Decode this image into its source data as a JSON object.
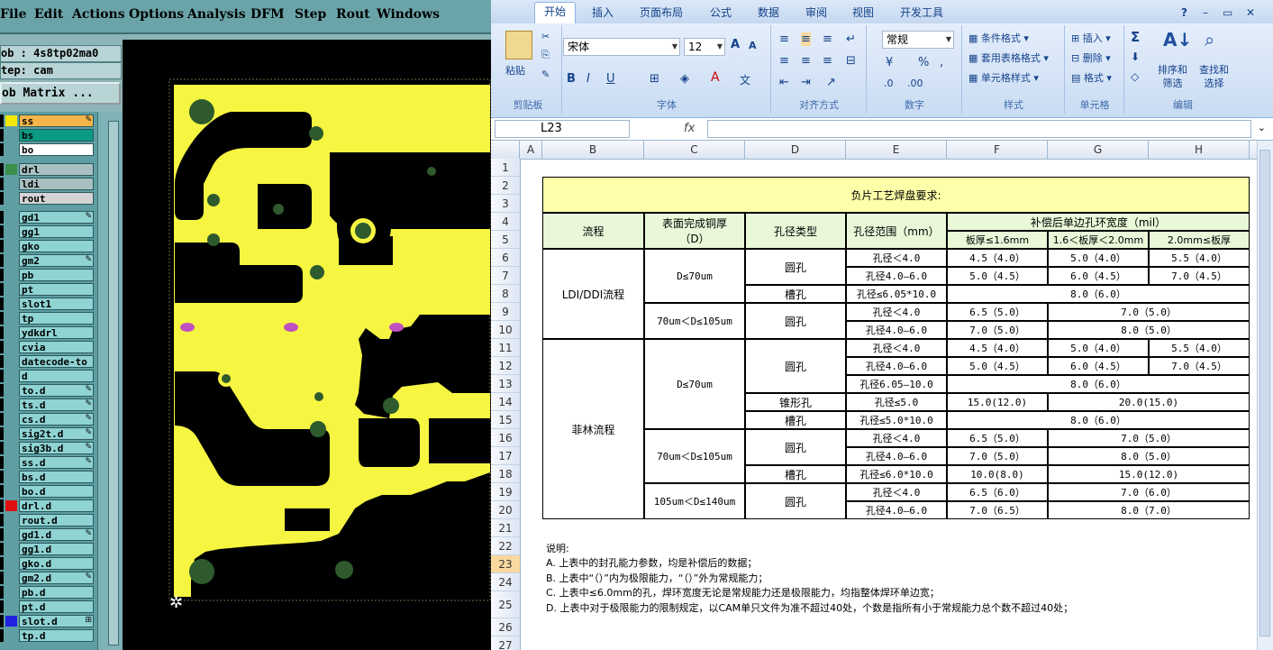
{
  "cam": {
    "menu": [
      "File",
      "Edit",
      "Actions",
      "Options",
      "Analysis",
      "DFM",
      "Step",
      "Rout",
      "Windows"
    ],
    "job": "ob : 4s8tp02ma0",
    "step": "tep: cam",
    "matrix_button": "ob Matrix ...",
    "layers": [
      {
        "name": "ss",
        "bg": "#f5b54a",
        "sw": "#f5e800",
        "mark": "✎"
      },
      {
        "name": "bs",
        "bg": "#0b9b83",
        "sw": "",
        "mark": ""
      },
      {
        "name": "bo",
        "bg": "#ffffff",
        "sw": "",
        "mark": ""
      },
      {
        "name": "drl",
        "bg": "#a9c0c2",
        "sw": "#3a8f4a",
        "mark": ""
      },
      {
        "name": "ldi",
        "bg": "#a9c0c2",
        "sw": "",
        "mark": ""
      },
      {
        "name": "rout",
        "bg": "#d4d4d4",
        "sw": "",
        "mark": ""
      },
      {
        "name": "gd1",
        "bg": "#8fd3d3",
        "sw": "",
        "mark": "✎"
      },
      {
        "name": "gg1",
        "bg": "#8fd3d3",
        "sw": "",
        "mark": ""
      },
      {
        "name": "gko",
        "bg": "#8fd3d3",
        "sw": "",
        "mark": ""
      },
      {
        "name": "gm2",
        "bg": "#8fd3d3",
        "sw": "",
        "mark": "✎"
      },
      {
        "name": "pb",
        "bg": "#8fd3d3",
        "sw": "",
        "mark": ""
      },
      {
        "name": "pt",
        "bg": "#8fd3d3",
        "sw": "",
        "mark": ""
      },
      {
        "name": "slot1",
        "bg": "#8fd3d3",
        "sw": "",
        "mark": ""
      },
      {
        "name": "tp",
        "bg": "#8fd3d3",
        "sw": "",
        "mark": ""
      },
      {
        "name": "ydkdrl",
        "bg": "#8fd3d3",
        "sw": "",
        "mark": ""
      },
      {
        "name": "cvia",
        "bg": "#8fd3d3",
        "sw": "",
        "mark": ""
      },
      {
        "name": "datecode-to",
        "bg": "#8fd3d3",
        "sw": "",
        "mark": ""
      },
      {
        "name": "d",
        "bg": "#8fd3d3",
        "sw": "",
        "mark": ""
      },
      {
        "name": "to.d",
        "bg": "#8fd3d3",
        "sw": "",
        "mark": "✎"
      },
      {
        "name": "ts.d",
        "bg": "#8fd3d3",
        "sw": "",
        "mark": "✎"
      },
      {
        "name": "cs.d",
        "bg": "#8fd3d3",
        "sw": "",
        "mark": "✎"
      },
      {
        "name": "sig2t.d",
        "bg": "#8fd3d3",
        "sw": "",
        "mark": "✎"
      },
      {
        "name": "sig3b.d",
        "bg": "#8fd3d3",
        "sw": "",
        "mark": "✎"
      },
      {
        "name": "ss.d",
        "bg": "#8fd3d3",
        "sw": "",
        "mark": "✎"
      },
      {
        "name": "bs.d",
        "bg": "#8fd3d3",
        "sw": "",
        "mark": ""
      },
      {
        "name": "bo.d",
        "bg": "#8fd3d3",
        "sw": "",
        "mark": ""
      },
      {
        "name": "drl.d",
        "bg": "#8fd3d3",
        "sw": "#e01010",
        "mark": ""
      },
      {
        "name": "rout.d",
        "bg": "#8fd3d3",
        "sw": "",
        "mark": ""
      },
      {
        "name": "gd1.d",
        "bg": "#8fd3d3",
        "sw": "",
        "mark": "✎"
      },
      {
        "name": "gg1.d",
        "bg": "#8fd3d3",
        "sw": "",
        "mark": ""
      },
      {
        "name": "gko.d",
        "bg": "#8fd3d3",
        "sw": "",
        "mark": ""
      },
      {
        "name": "gm2.d",
        "bg": "#8fd3d3",
        "sw": "",
        "mark": "✎"
      },
      {
        "name": "pb.d",
        "bg": "#8fd3d3",
        "sw": "",
        "mark": ""
      },
      {
        "name": "pt.d",
        "bg": "#8fd3d3",
        "sw": "",
        "mark": ""
      },
      {
        "name": "slot.d",
        "bg": "#8fd3d3",
        "sw": "#2020e0",
        "mark": "⊞"
      },
      {
        "name": "tp.d",
        "bg": "#8fd3d3",
        "sw": "",
        "mark": ""
      }
    ],
    "colors": {
      "copper": "#f5f542",
      "board": "#000000",
      "pad": "#2e5a2e",
      "slot": "#c050c0"
    }
  },
  "excel": {
    "tabs": [
      "开始",
      "插入",
      "页面布局",
      "公式",
      "数据",
      "审阅",
      "视图",
      "开发工具"
    ],
    "ribbon": {
      "paste": "粘贴",
      "clipboard": "剪贴板",
      "font_name": "宋体",
      "font_size": "12",
      "font_group": "字体",
      "align_group": "对齐方式",
      "number_format": "常规",
      "number_group": "数字",
      "cond_format": "条件格式",
      "table_format": "套用表格格式",
      "cell_style": "单元格样式",
      "style_group": "样式",
      "insert": "插入",
      "delete": "删除",
      "format": "格式",
      "cells_group": "单元格",
      "sort_filter": "排序和\n筛选",
      "find_select": "查找和\n选择",
      "edit_group": "编辑",
      "sigma": "Σ"
    },
    "name_box": "L23",
    "fx": "fx",
    "columns": [
      "A",
      "B",
      "C",
      "D",
      "E",
      "F",
      "G",
      "H"
    ],
    "rows": [
      "1",
      "2",
      "3",
      "4",
      "5",
      "6",
      "7",
      "8",
      "9",
      "10",
      "11",
      "12",
      "13",
      "14",
      "15",
      "16",
      "17",
      "18",
      "19",
      "20",
      "21",
      "22",
      "23",
      "24",
      "25",
      "26",
      "27"
    ],
    "selected_row": "23",
    "table": {
      "title": "负片工艺焊盘要求:",
      "h_process": "流程",
      "h_thickness": "表面完成铜厚\n（D）",
      "h_hole_type": "孔径类型",
      "h_hole_range": "孔径范围（mm）",
      "h_ring": "补偿后单边孔环宽度（mil）",
      "h_t1": "板厚≤1.6mm",
      "h_t2": "1.6＜板厚＜2.0mm",
      "h_t3": "2.0mm≤板厚",
      "proc_ldi": "LDI/DDI流程",
      "proc_film": "菲林流程",
      "d1": "D≤70um",
      "d2": "70um＜D≤105um",
      "d3": "D≤70um",
      "d4": "70um＜D≤105um",
      "d5": "105um＜D≤140um",
      "round": "圆孔",
      "slot": "槽孔",
      "taper": "锥形孔",
      "r6": [
        "孔径＜4.0",
        "4.5（4.0）",
        "5.0（4.0）",
        "5.5（4.0）"
      ],
      "r7": [
        "孔径4.0—6.0",
        "5.0（4.5）",
        "6.0（4.5）",
        "7.0（4.5）"
      ],
      "r8": [
        "孔径≤6.05*10.0",
        "8.0（6.0）"
      ],
      "r9": [
        "孔径＜4.0",
        "6.5（5.0）",
        "7.0（5.0）"
      ],
      "r10": [
        "孔径4.0—6.0",
        "7.0（5.0）",
        "8.0（5.0）"
      ],
      "r11": [
        "孔径＜4.0",
        "4.5（4.0）",
        "5.0（4.0）",
        "5.5（4.0）"
      ],
      "r12": [
        "孔径4.0—6.0",
        "5.0（4.5）",
        "6.0（4.5）",
        "7.0（4.5）"
      ],
      "r13": [
        "孔径6.05—10.0",
        "8.0（6.0）"
      ],
      "r14": [
        "孔径≤5.0",
        "15.0(12.0)",
        "20.0(15.0)"
      ],
      "r15": [
        "孔径≤5.0*10.0",
        "8.0（6.0）"
      ],
      "r16": [
        "孔径＜4.0",
        "6.5（5.0）",
        "7.0（5.0）"
      ],
      "r17": [
        "孔径4.0—6.0",
        "7.0（5.0）",
        "8.0（5.0）"
      ],
      "r18": [
        "孔径≤6.0*10.0",
        "10.0(8.0)",
        "15.0(12.0)"
      ],
      "r19": [
        "孔径＜4.0",
        "6.5（6.0）",
        "7.0（6.0）"
      ],
      "r20": [
        "孔径4.0—6.0",
        "7.0（6.5）",
        "8.0（7.0）"
      ]
    },
    "notes": [
      "说明:",
      "A. 上表中的封孔能力参数，均是补偿后的数据；",
      "B. 上表中“（）”内为极限能力，“（）”外为常规能力；",
      "C. 上表中≤6.0mm的孔，焊环宽度无论是常规能力还是极限能力，均指整体焊环单边宽；",
      "D. 上表中对于极限能力的限制规定，以CAM单只文件为准不超过40处，个数是指所有小于常规能力总个数不超过40处；"
    ]
  }
}
